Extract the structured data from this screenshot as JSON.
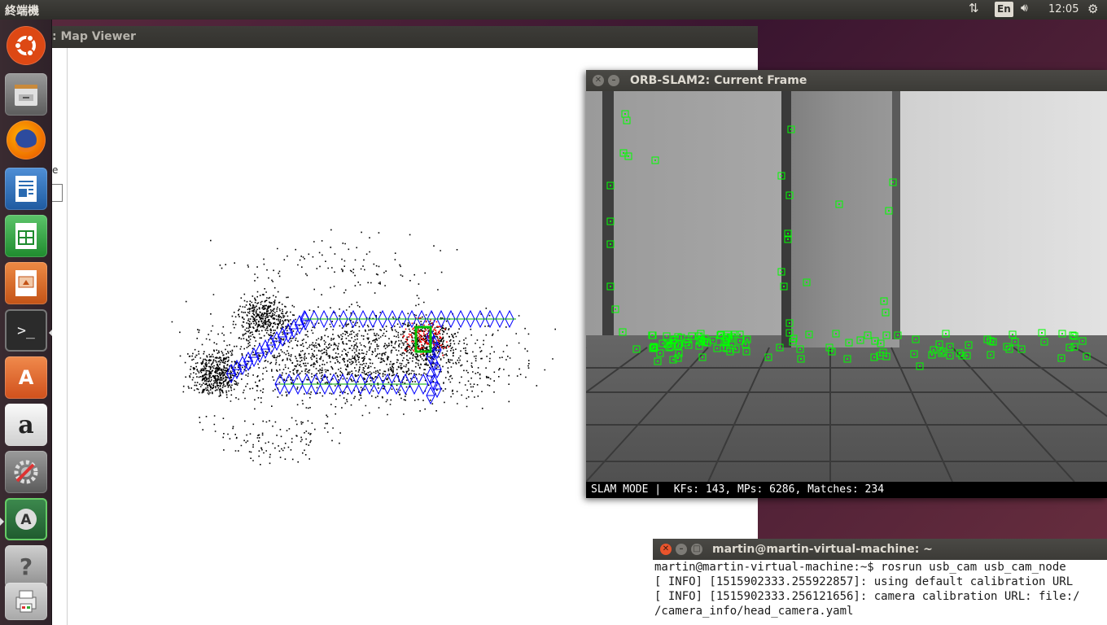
{
  "top_panel": {
    "app_title": "終端機",
    "keyboard": "En",
    "clock": "12:05",
    "icons": [
      "network-icon",
      "keyboard-icon",
      "volume-icon",
      "settings-icon"
    ]
  },
  "launcher": {
    "items": [
      {
        "name": "ubuntu-dash",
        "icon": "ubuntu-logo-icon",
        "color": "#dd4814"
      },
      {
        "name": "files",
        "icon": "file-cabinet-icon",
        "color": "#6d6d6d"
      },
      {
        "name": "firefox",
        "icon": "firefox-icon",
        "color": "#e66000"
      },
      {
        "name": "writer",
        "icon": "document-icon",
        "color": "#2a6bb2"
      },
      {
        "name": "calc",
        "icon": "spreadsheet-icon",
        "color": "#2e9b3a"
      },
      {
        "name": "impress",
        "icon": "presentation-icon",
        "color": "#d4662a"
      },
      {
        "name": "terminal",
        "icon": "terminal-icon",
        "color": "#2b2b2b"
      },
      {
        "name": "software-center",
        "icon": "shopping-bag-icon",
        "color": "#e26a2c"
      },
      {
        "name": "amazon",
        "icon": "amazon-icon",
        "color": "#e9e9e9"
      },
      {
        "name": "system-settings",
        "icon": "wrench-gear-icon",
        "color": "#7a7a7a"
      },
      {
        "name": "software-updater",
        "icon": "updater-icon",
        "color": "#2c6e3c"
      },
      {
        "name": "help",
        "icon": "help-icon",
        "color": "#a8a8a8"
      },
      {
        "name": "trash",
        "icon": "printer-icon",
        "color": "#bdbdbd"
      }
    ]
  },
  "map_viewer": {
    "title": ": Map Viewer",
    "side_label": "e"
  },
  "current_frame": {
    "title": "ORB-SLAM2: Current Frame",
    "status": "SLAM MODE |  KFs: 143, MPs: 6286, Matches: 234"
  },
  "terminal": {
    "title": "martin@martin-virtual-machine: ~",
    "lines": [
      "martin@martin-virtual-machine:~$ rosrun usb_cam usb_cam_node",
      "[ INFO] [1515902333.255922857]: using default calibration URL",
      "[ INFO] [1515902333.256121656]: camera calibration URL: file:/",
      "/camera_info/head_camera.yaml"
    ]
  },
  "colors": {
    "keypoint": "#00ff00",
    "keyframe": "#0000ff",
    "map_point": "#000000",
    "reference_point": "#ff0000",
    "terminal_bg": "#300a24"
  }
}
